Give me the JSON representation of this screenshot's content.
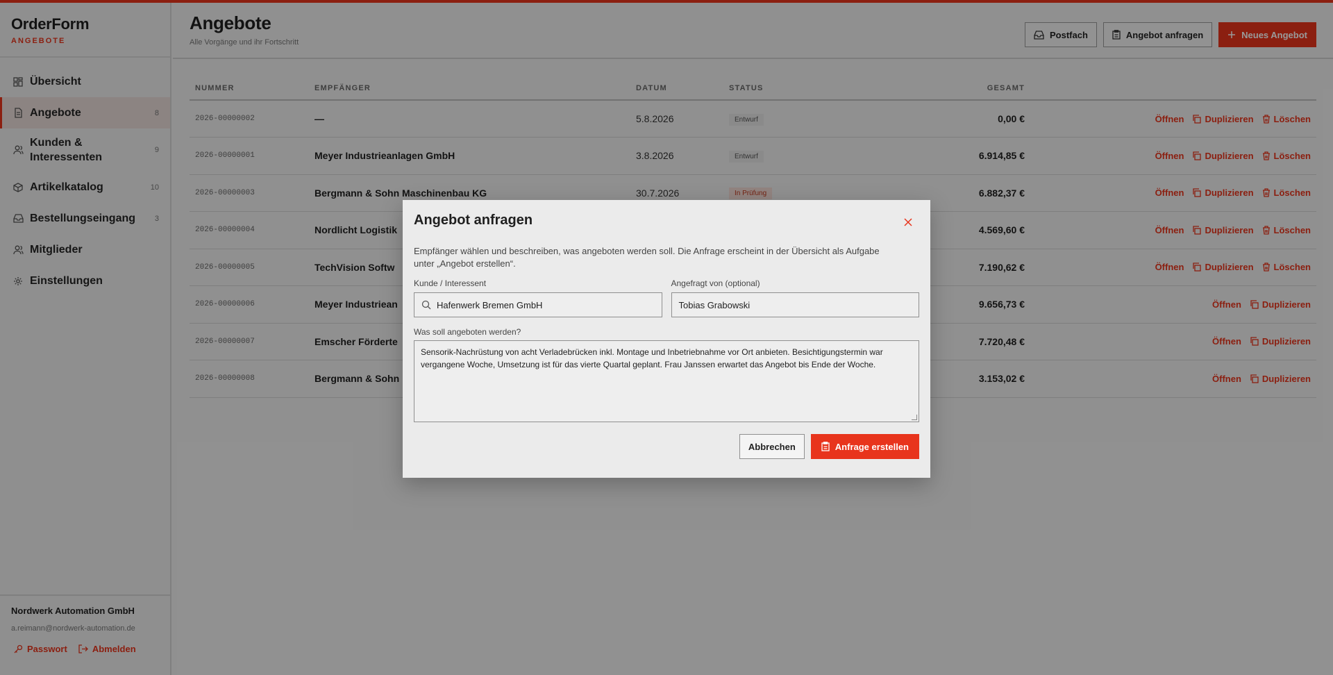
{
  "app": {
    "name": "OrderForm",
    "section": "ANGEBOTE"
  },
  "colors": {
    "accent": "#e8341c"
  },
  "sidebar": {
    "items": [
      {
        "label": "Übersicht",
        "count": "",
        "icon": "grid-icon"
      },
      {
        "label": "Angebote",
        "count": "8",
        "icon": "document-icon",
        "active": true
      },
      {
        "label": "Kunden & Interessenten",
        "count": "9",
        "icon": "users-icon"
      },
      {
        "label": "Artikelkatalog",
        "count": "10",
        "icon": "box-icon"
      },
      {
        "label": "Bestellungseingang",
        "count": "3",
        "icon": "inbox-icon"
      },
      {
        "label": "Mitglieder",
        "count": "",
        "icon": "users-icon"
      },
      {
        "label": "Einstellungen",
        "count": "",
        "icon": "gear-icon"
      }
    ],
    "footer": {
      "org": "Nordwerk Automation GmbH",
      "email": "a.reimann@nordwerk-automation.de",
      "password": "Passwort",
      "logout": "Abmelden"
    }
  },
  "header": {
    "title": "Angebote",
    "subtitle": "Alle Vorgänge und ihr Fortschritt",
    "postfach": "Postfach",
    "request": "Angebot anfragen",
    "new_offer": "Neues Angebot"
  },
  "table": {
    "headers": {
      "number": "NUMMER",
      "recipient": "EMPFÄNGER",
      "date": "DATUM",
      "status": "STATUS",
      "total": "GESAMT"
    },
    "actions": {
      "open": "Öffnen",
      "duplicate": "Duplizieren",
      "delete": "Löschen"
    },
    "rows": [
      {
        "number": "2026-00000002",
        "recipient": "—",
        "date": "5.8.2026",
        "status": "Entwurf",
        "total": "0,00 €"
      },
      {
        "number": "2026-00000001",
        "recipient": "Meyer Industrieanlagen GmbH",
        "date": "3.8.2026",
        "status": "Entwurf",
        "total": "6.914,85 €"
      },
      {
        "number": "2026-00000003",
        "recipient": "Bergmann & Sohn Maschinenbau KG",
        "date": "30.7.2026",
        "status": "In Prüfung",
        "total": "6.882,37 €"
      },
      {
        "number": "2026-00000004",
        "recipient": "Nordlicht Logistik",
        "date": "",
        "status": "",
        "total": "4.569,60 €"
      },
      {
        "number": "2026-00000005",
        "recipient": "TechVision Softw",
        "date": "",
        "status": "",
        "total": "7.190,62 €"
      },
      {
        "number": "2026-00000006",
        "recipient": "Meyer Industriean",
        "date": "",
        "status": "",
        "total": "9.656,73 €"
      },
      {
        "number": "2026-00000007",
        "recipient": "Emscher Förderte",
        "date": "",
        "status": "",
        "total": "7.720,48 €"
      },
      {
        "number": "2026-00000008",
        "recipient": "Bergmann & Sohn",
        "date": "",
        "status": "",
        "total": "3.153,02 €"
      }
    ]
  },
  "modal": {
    "title": "Angebot anfragen",
    "description": "Empfänger wählen und beschreiben, was angeboten werden soll. Die Anfrage erscheint in der Übersicht als Aufgabe unter „Angebot erstellen“.",
    "customer_label": "Kunde / Interessent",
    "customer_value": "Hafenwerk Bremen GmbH",
    "requested_by_label": "Angefragt von (optional)",
    "requested_by_value": "Tobias Grabowski",
    "what_label": "Was soll angeboten werden?",
    "what_value": "Sensorik-Nachrüstung von acht Verladebrücken inkl. Montage und Inbetriebnahme vor Ort anbieten. Besichtigungstermin war vergangene Woche, Umsetzung ist für das vierte Quartal geplant. Frau Janssen erwartet das Angebot bis Ende der Woche.",
    "cancel": "Abbrechen",
    "submit": "Anfrage erstellen"
  }
}
